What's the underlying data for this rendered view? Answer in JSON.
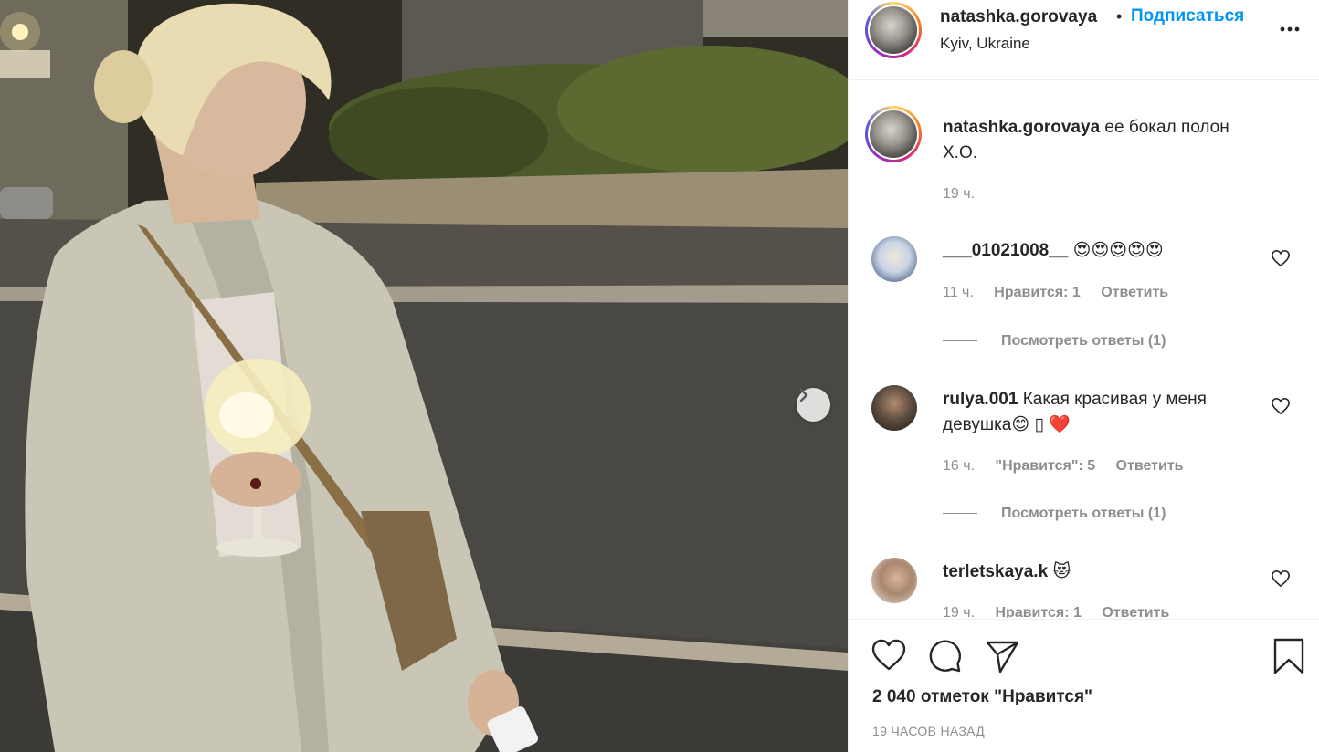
{
  "post": {
    "username": "natashka.gorovaya",
    "separator": "•",
    "follow_label": "Подписаться",
    "location": "Kyiv, Ukraine",
    "more_icon": "more-horizontal-icon"
  },
  "caption": {
    "username": "natashka.gorovaya",
    "text": "ее бокал полон",
    "text2": "X.O.",
    "time": "19 ч."
  },
  "comments": [
    {
      "username": "___01021008__",
      "text": "😍😍😍😍😍",
      "time": "11 ч.",
      "likes": "Нравится: 1",
      "reply_label": "Ответить",
      "view_replies": "Посмотреть ответы (1)"
    },
    {
      "username": "rulya.001",
      "text": "Какая красивая у меня девушка😊 ▯ ❤️",
      "time": "16 ч.",
      "likes": "\"Нравится\": 5",
      "reply_label": "Ответить",
      "view_replies": "Посмотреть ответы (1)"
    },
    {
      "username": "terletskaya.k",
      "text": "😻",
      "time": "19 ч.",
      "likes": "Нравится: 1",
      "reply_label": "Ответить"
    }
  ],
  "footer": {
    "likes_text": "2 040 отметок \"Нравится\"",
    "posted_ago": "19 ЧАСОВ НАЗАД"
  },
  "colors": {
    "accent": "#0095f6",
    "text": "#262626",
    "muted": "#8e8e8e"
  }
}
